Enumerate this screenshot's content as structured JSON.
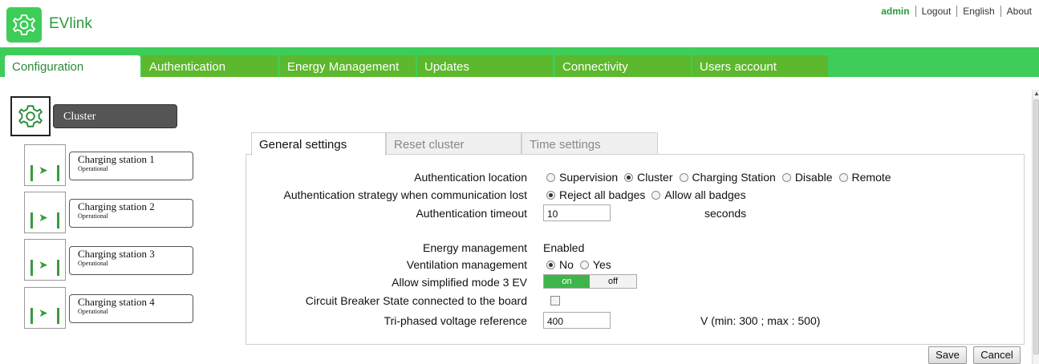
{
  "app": {
    "title": "EVlink",
    "brand_color": "#3dcd58",
    "logo_icon": "gear-icon"
  },
  "top_links": {
    "user": "admin",
    "logout": "Logout",
    "language": "English",
    "about": "About"
  },
  "main_tabs": [
    "Configuration",
    "Authentication",
    "Energy Management",
    "Updates",
    "Connectivity",
    "Users account"
  ],
  "sidebar": {
    "cluster_label": "Cluster",
    "stations": [
      {
        "name": "Charging station 1",
        "status": "Operational"
      },
      {
        "name": "Charging station 2",
        "status": "Operational"
      },
      {
        "name": "Charging station 3",
        "status": "Operational"
      },
      {
        "name": "Charging station 4",
        "status": "Operational"
      }
    ]
  },
  "sub_tabs": [
    "General settings",
    "Reset cluster",
    "Time settings"
  ],
  "settings": {
    "auth_location": {
      "label": "Authentication location",
      "options": [
        "Supervision",
        "Cluster",
        "Charging Station",
        "Disable",
        "Remote"
      ],
      "selected": "Cluster"
    },
    "auth_strategy": {
      "label": "Authentication strategy when communication lost",
      "options": [
        "Reject all badges",
        "Allow all badges"
      ],
      "selected": "Reject all badges"
    },
    "auth_timeout": {
      "label": "Authentication timeout",
      "value": "10",
      "unit": "seconds"
    },
    "energy_mgmt": {
      "label": "Energy management",
      "value": "Enabled"
    },
    "ventilation": {
      "label": "Ventilation management",
      "options": [
        "No",
        "Yes"
      ],
      "selected": "No"
    },
    "simplified_mode": {
      "label": "Allow simplified mode 3 EV",
      "on_label": "on",
      "off_label": "off",
      "state": "on"
    },
    "circuit_breaker": {
      "label": "Circuit Breaker State connected to the board",
      "checked": false
    },
    "voltage_ref": {
      "label": "Tri-phased voltage reference",
      "value": "400",
      "unit": "V (min: 300 ; max : 500)"
    }
  },
  "buttons": {
    "save": "Save",
    "cancel": "Cancel"
  }
}
